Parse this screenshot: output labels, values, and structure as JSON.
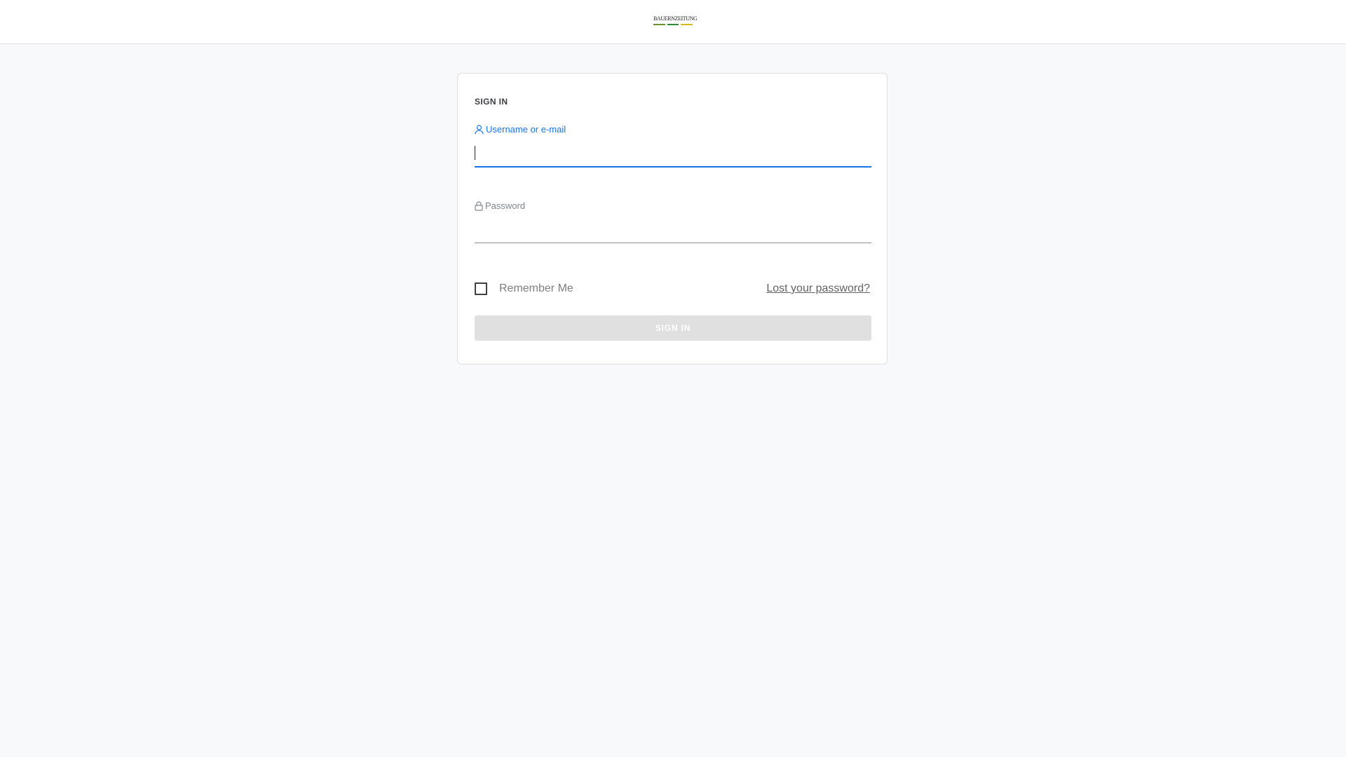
{
  "header": {
    "logo": {
      "wordmark": "BauernZeitung",
      "accent_colors": [
        "#6a8f2e",
        "#2e8b3a",
        "#d8b91c"
      ]
    }
  },
  "signin": {
    "title": "SIGN IN",
    "username": {
      "label": "Username or e-mail",
      "icon": "user-icon",
      "value": "",
      "focused": true
    },
    "password": {
      "label": "Password",
      "icon": "lock-icon",
      "value": ""
    },
    "remember_me": {
      "label": "Remember Me",
      "checked": false
    },
    "lost_password_link": "Lost your password?",
    "submit_label": "SIGN IN",
    "submit_disabled": true
  },
  "colors": {
    "accent": "#1a73e8",
    "page_background": "#f8f9fa",
    "button_disabled": "#e0e0e0"
  }
}
